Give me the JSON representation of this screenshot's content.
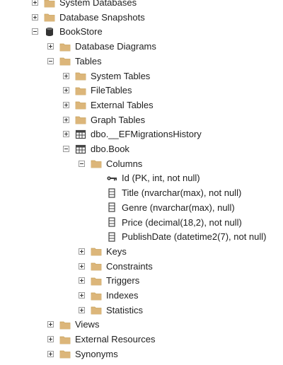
{
  "tree": {
    "nodes": [
      {
        "label": "System Databases",
        "level": 0,
        "toggle": "plus",
        "icon": "folder-icon"
      },
      {
        "label": "Database Snapshots",
        "level": 0,
        "toggle": "plus",
        "icon": "folder-icon"
      },
      {
        "label": "BookStore",
        "level": 0,
        "toggle": "minus",
        "icon": "database-icon"
      },
      {
        "label": "Database Diagrams",
        "level": 1,
        "toggle": "plus",
        "icon": "folder-icon"
      },
      {
        "label": "Tables",
        "level": 1,
        "toggle": "minus",
        "icon": "folder-icon"
      },
      {
        "label": "System Tables",
        "level": 2,
        "toggle": "plus",
        "icon": "folder-icon"
      },
      {
        "label": "FileTables",
        "level": 2,
        "toggle": "plus",
        "icon": "folder-icon"
      },
      {
        "label": "External Tables",
        "level": 2,
        "toggle": "plus",
        "icon": "folder-icon"
      },
      {
        "label": "Graph Tables",
        "level": 2,
        "toggle": "plus",
        "icon": "folder-icon"
      },
      {
        "label": "dbo.__EFMigrationsHistory",
        "level": 2,
        "toggle": "plus",
        "icon": "table-icon"
      },
      {
        "label": "dbo.Book",
        "level": 2,
        "toggle": "minus",
        "icon": "table-icon"
      },
      {
        "label": "Columns",
        "level": 3,
        "toggle": "minus",
        "icon": "folder-icon"
      },
      {
        "label": "Id (PK, int, not null)",
        "level": 4,
        "toggle": "none",
        "icon": "key-icon"
      },
      {
        "label": "Title (nvarchar(max), not null)",
        "level": 4,
        "toggle": "none",
        "icon": "column-icon"
      },
      {
        "label": "Genre (nvarchar(max), null)",
        "level": 4,
        "toggle": "none",
        "icon": "column-icon"
      },
      {
        "label": "Price (decimal(18,2), not null)",
        "level": 4,
        "toggle": "none",
        "icon": "column-icon"
      },
      {
        "label": "PublishDate (datetime2(7), not null)",
        "level": 4,
        "toggle": "none",
        "icon": "column-icon"
      },
      {
        "label": "Keys",
        "level": 3,
        "toggle": "plus",
        "icon": "folder-icon"
      },
      {
        "label": "Constraints",
        "level": 3,
        "toggle": "plus",
        "icon": "folder-icon"
      },
      {
        "label": "Triggers",
        "level": 3,
        "toggle": "plus",
        "icon": "folder-icon"
      },
      {
        "label": "Indexes",
        "level": 3,
        "toggle": "plus",
        "icon": "folder-icon"
      },
      {
        "label": "Statistics",
        "level": 3,
        "toggle": "plus",
        "icon": "folder-icon"
      },
      {
        "label": "Views",
        "level": 1,
        "toggle": "plus",
        "icon": "folder-icon"
      },
      {
        "label": "External Resources",
        "level": 1,
        "toggle": "plus",
        "icon": "folder-icon"
      },
      {
        "label": "Synonyms",
        "level": 1,
        "toggle": "plus",
        "icon": "folder-icon"
      }
    ]
  },
  "colors": {
    "folder": "#dcb67a",
    "folder_dark": "#c9a35c",
    "database": "#333333",
    "table_grid": "#444444",
    "key": "#3a3a3a"
  }
}
